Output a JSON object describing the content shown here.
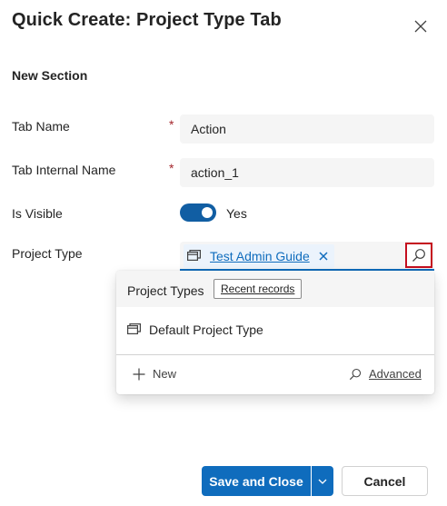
{
  "dialog": {
    "title": "Quick Create: Project Type Tab"
  },
  "section": {
    "title": "New Section"
  },
  "fields": {
    "tab_name": {
      "label": "Tab Name",
      "required": "*",
      "value": "Action"
    },
    "tab_internal_name": {
      "label": "Tab Internal Name",
      "required": "*",
      "value": "action_1"
    },
    "is_visible": {
      "label": "Is Visible",
      "value_label": "Yes",
      "checked": true
    },
    "project_type": {
      "label": "Project Type",
      "selected_value": "Test Admin Guide"
    }
  },
  "lookup_flyout": {
    "header_label": "Project Types",
    "recent_records_label": "Recent records",
    "results": [
      {
        "label": "Default Project Type"
      }
    ],
    "new_label": "New",
    "advanced_label": "Advanced"
  },
  "footer": {
    "save_label": "Save and Close",
    "cancel_label": "Cancel"
  },
  "colors": {
    "accent": "#0f6cbd",
    "toggle_on": "#115ea3",
    "highlight_border": "#c50f1f",
    "required": "#a4262c"
  },
  "icons": {
    "close": "close-icon",
    "lookup_search": "search-icon",
    "record": "entity-record-icon",
    "remove": "dismiss-icon",
    "add": "add-icon",
    "chevron": "chevron-down-icon"
  }
}
